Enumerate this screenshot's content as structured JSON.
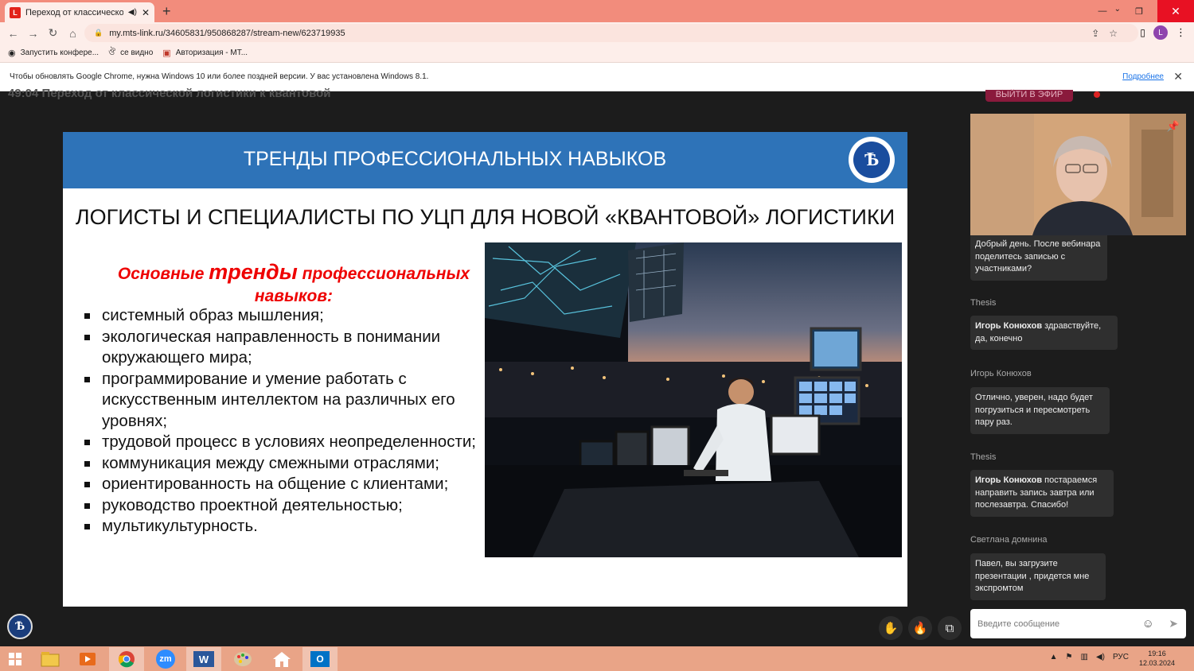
{
  "browser": {
    "tab_title": "Переход от классической л",
    "tab_favicon": "L",
    "new_tab": "+",
    "url": "my.mts-link.ru/34605831/950868287/stream-new/623719935",
    "profile_letter": "L",
    "bookmarks": [
      {
        "icon": "globe-icon",
        "glyph": "◉",
        "label": "Запустить конфере..."
      },
      {
        "icon": "bird-icon",
        "glyph": "ঔ",
        "label": "се видно"
      },
      {
        "icon": "lock-icon",
        "glyph": "▣",
        "label": "Авторизация - МТ..."
      }
    ],
    "info_message": "Чтобы обновлять Google Chrome, нужна Windows 10 или более поздней версии. У вас установлена Windows 8.1.",
    "info_link": "Подробнее"
  },
  "webinar": {
    "header_partial": "49:04   Переход от классической логистики к квантовой",
    "live_button": "ВЫЙТИ В ЭФИР"
  },
  "slide": {
    "title": "ТРЕНДЫ ПРОФЕССИОНАЛЬНЫХ НАВЫКОВ",
    "logo": "Ѣ",
    "subtitle": "ЛОГИСТЫ И СПЕЦИАЛИСТЫ ПО УЦП ДЛЯ НОВОЙ «КВАНТОВОЙ» ЛОГИСТИКИ",
    "trends_heading": {
      "part1": "Основные ",
      "highlight": "тренды",
      "part2": " профессиональных навыков:"
    },
    "trends": [
      "системный образ мышления;",
      "экологическая направленность в понимании окружающего мира;",
      "программирование и умение работать с искусственным интеллектом на различных его уровнях;",
      "трудовой процесс в условиях неопределенности;",
      "коммуникация между смежными отраслями;",
      "ориентированность на общение с клиентами;",
      "руководство проектной деятельностью;",
      "мультикультурность."
    ]
  },
  "controls": {
    "hand": "✋",
    "fire": "🔥",
    "pip": "⧉"
  },
  "chat": {
    "messages": [
      {
        "author": "",
        "name": "",
        "text": "Добрый день. После вебинара поделитесь записью с участниками?"
      },
      {
        "author": "Thesis",
        "name": "Игорь Конюхов",
        "text": " здравствуйте, да, конечно"
      },
      {
        "author": "Игорь Конюхов",
        "name": "",
        "text": "Отлично, уверен, надо будет погрузиться и пересмотреть пару раз."
      },
      {
        "author": "Thesis",
        "name": "Игорь Конюхов",
        "text": " постараемся направить запись завтра или послезавтра. Спасибо!"
      },
      {
        "author": "Светлана домнина",
        "name": "",
        "text": "Павел, вы загрузите презентации , придется мне экспромтом"
      }
    ],
    "input_placeholder": "Введите сообщение"
  },
  "taskbar": {
    "apps": [
      "start-icon",
      "explorer-icon",
      "media-icon",
      "chrome-icon",
      "zoom-icon",
      "word-icon",
      "paint-icon",
      "home-icon",
      "outlook-icon"
    ],
    "zoom_label": "zm",
    "word_label": "W",
    "outlook_label": "O",
    "language": "РУС",
    "time": "19:16",
    "date": "12.03.2024"
  }
}
